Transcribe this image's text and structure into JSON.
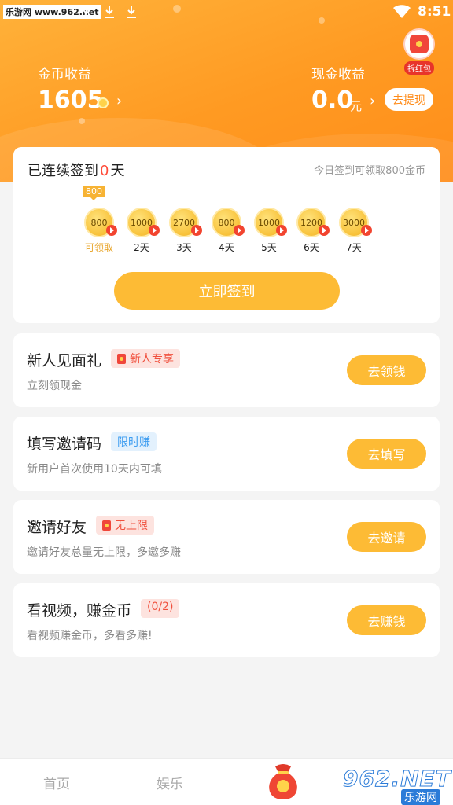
{
  "status_bar": {
    "watermark": "乐游网 www.962.net",
    "time": "8:51"
  },
  "header": {
    "hongbao_label": "拆红包",
    "coin_label": "金币收益",
    "coin_value": "1605",
    "cash_label": "现金收益",
    "cash_value": "0.0",
    "cash_unit": "元",
    "withdraw_label": "去提现",
    "colors": {
      "gradient_start": "#ffb23a",
      "gradient_end": "#ff8d1a"
    }
  },
  "signin": {
    "title_prefix": "已连续签到",
    "streak": "0",
    "title_suffix": "天",
    "hint": "今日签到可领取800金币",
    "badge": "800",
    "days": [
      {
        "amount": "800",
        "label": "可领取"
      },
      {
        "amount": "1000",
        "label": "2天"
      },
      {
        "amount": "2700",
        "label": "3天"
      },
      {
        "amount": "800",
        "label": "4天"
      },
      {
        "amount": "1000",
        "label": "5天"
      },
      {
        "amount": "1200",
        "label": "6天"
      },
      {
        "amount": "3000",
        "label": "7天"
      }
    ],
    "button": "立即签到"
  },
  "tasks": [
    {
      "title": "新人见面礼",
      "tag": "新人专享",
      "desc": "立刻领现金",
      "button": "去领钱"
    },
    {
      "title": "填写邀请码",
      "tag": "限时赚",
      "desc": "新用户首次使用10天内可填",
      "button": "去填写"
    },
    {
      "title": "邀请好友",
      "tag": "无上限",
      "desc": "邀请好友总量无上限，多邀多赚",
      "button": "去邀请"
    },
    {
      "title": "看视频，赚金币",
      "tag": "(0/2)",
      "desc": "看视频赚金币，多看多赚!",
      "button": "去赚钱"
    }
  ],
  "bottom_nav": {
    "home": "首页",
    "entertainment": "娱乐"
  },
  "watermark_br": {
    "big": "962.NET",
    "small": "乐游网"
  },
  "colors": {
    "accent": "#fdbb35",
    "highlight_red": "#ff4d3a"
  }
}
